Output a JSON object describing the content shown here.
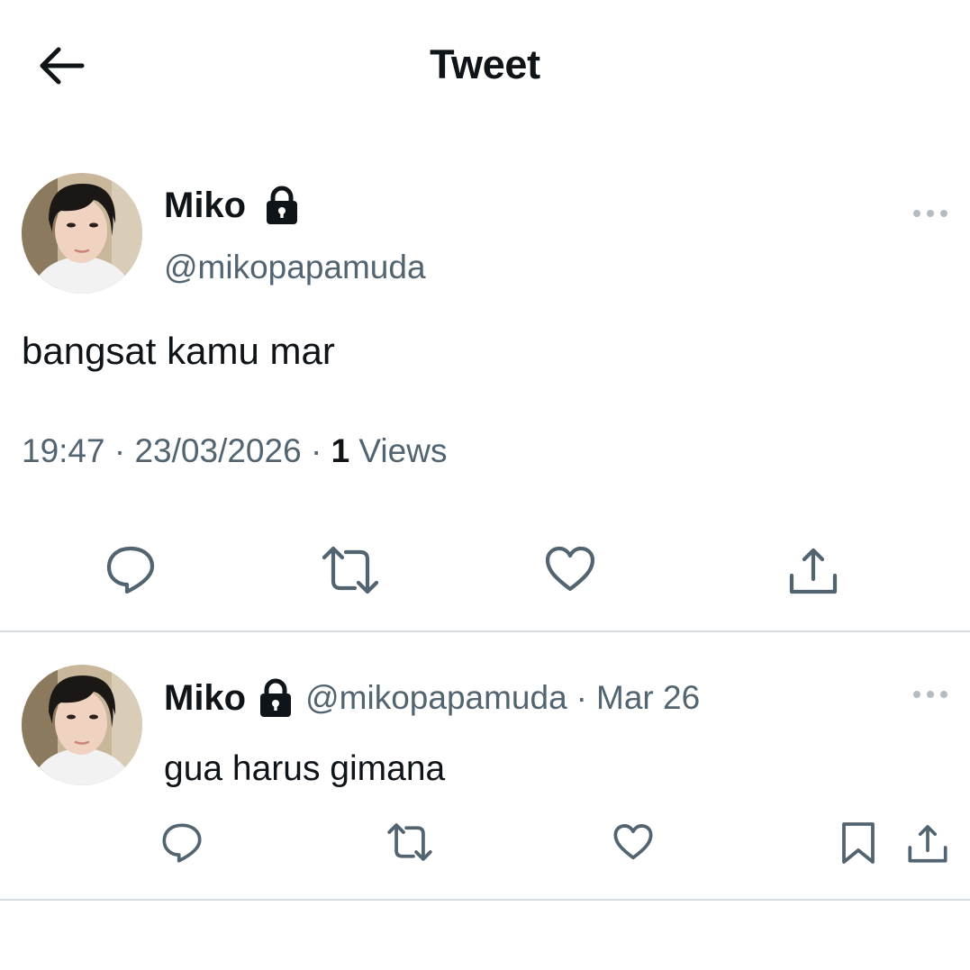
{
  "header": {
    "title": "Tweet",
    "back_icon": "arrow-left-icon"
  },
  "main_tweet": {
    "author": {
      "display_name": "Miko",
      "handle": "@mikopapamuda",
      "protected_icon": "lock-icon"
    },
    "text": "bangsat kamu mar",
    "time": "19:47",
    "date": "23/03/2026",
    "views_count": "1",
    "views_label": "Views",
    "separator": "·",
    "actions": [
      "reply-icon",
      "retweet-icon",
      "like-icon",
      "share-icon"
    ]
  },
  "reply": {
    "author": {
      "display_name": "Miko",
      "handle": "@mikopapamuda",
      "protected_icon": "lock-icon"
    },
    "separator": "·",
    "date": "Mar 26",
    "text": "gua harus gimana",
    "actions": [
      "reply-icon",
      "retweet-icon",
      "like-icon",
      "bookmark-icon",
      "share-icon"
    ]
  },
  "colors": {
    "text_primary": "#0f1419",
    "text_secondary": "#536471",
    "divider": "#d7dce0",
    "background": "#ffffff"
  }
}
